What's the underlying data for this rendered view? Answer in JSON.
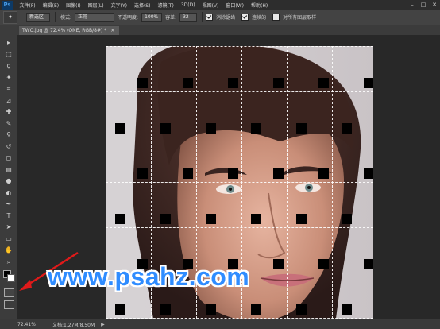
{
  "app": {
    "logo": "Ps"
  },
  "menu": [
    "文件(F)",
    "编辑(E)",
    "图像(I)",
    "图层(L)",
    "文字(Y)",
    "选择(S)",
    "滤镜(T)",
    "3D(D)",
    "视图(V)",
    "窗口(W)",
    "帮助(H)"
  ],
  "window_buttons": [
    "–",
    "□",
    "✕"
  ],
  "options": {
    "tool_icon": "magic-wand-icon",
    "mode_value": "新选区",
    "mode_label": "模式:",
    "mode_select": "正常",
    "opacity_label": "不透明度:",
    "opacity_value": "100%",
    "tolerance_label": "容差:",
    "tolerance_value": "32",
    "antialias_label": "消除锯齿",
    "contiguous_label": "连续的",
    "all_layers_label": "对所有图层取样"
  },
  "document_tab": {
    "title": "TWO.jpg @ 72.4% (ONE, RGB/8#) *",
    "close": "×"
  },
  "tools": [
    "move-icon",
    "marquee-icon",
    "lasso-icon",
    "magic-wand-icon",
    "crop-icon",
    "eyedropper-icon",
    "healing-brush-icon",
    "brush-icon",
    "clone-stamp-icon",
    "history-brush-icon",
    "eraser-icon",
    "gradient-icon",
    "blur-icon",
    "dodge-icon",
    "pen-icon",
    "type-icon",
    "path-selection-icon",
    "shape-icon",
    "hand-icon",
    "zoom-icon"
  ],
  "tool_glyphs": [
    "▸",
    "⬚",
    "ϙ",
    "✦",
    "⌗",
    "⊿",
    "✚",
    "✎",
    "⚲",
    "↺",
    "◻",
    "▤",
    "●",
    "◐",
    "✒",
    "T",
    "➤",
    "▭",
    "✋",
    "⌕"
  ],
  "colors": {
    "foreground": "#000000",
    "background": "#ffffff"
  },
  "watermark": "www.psahz.com",
  "status": {
    "zoom": "72.41%",
    "doc": "文档:1.27M/8.50M",
    "arrow": "▶"
  }
}
